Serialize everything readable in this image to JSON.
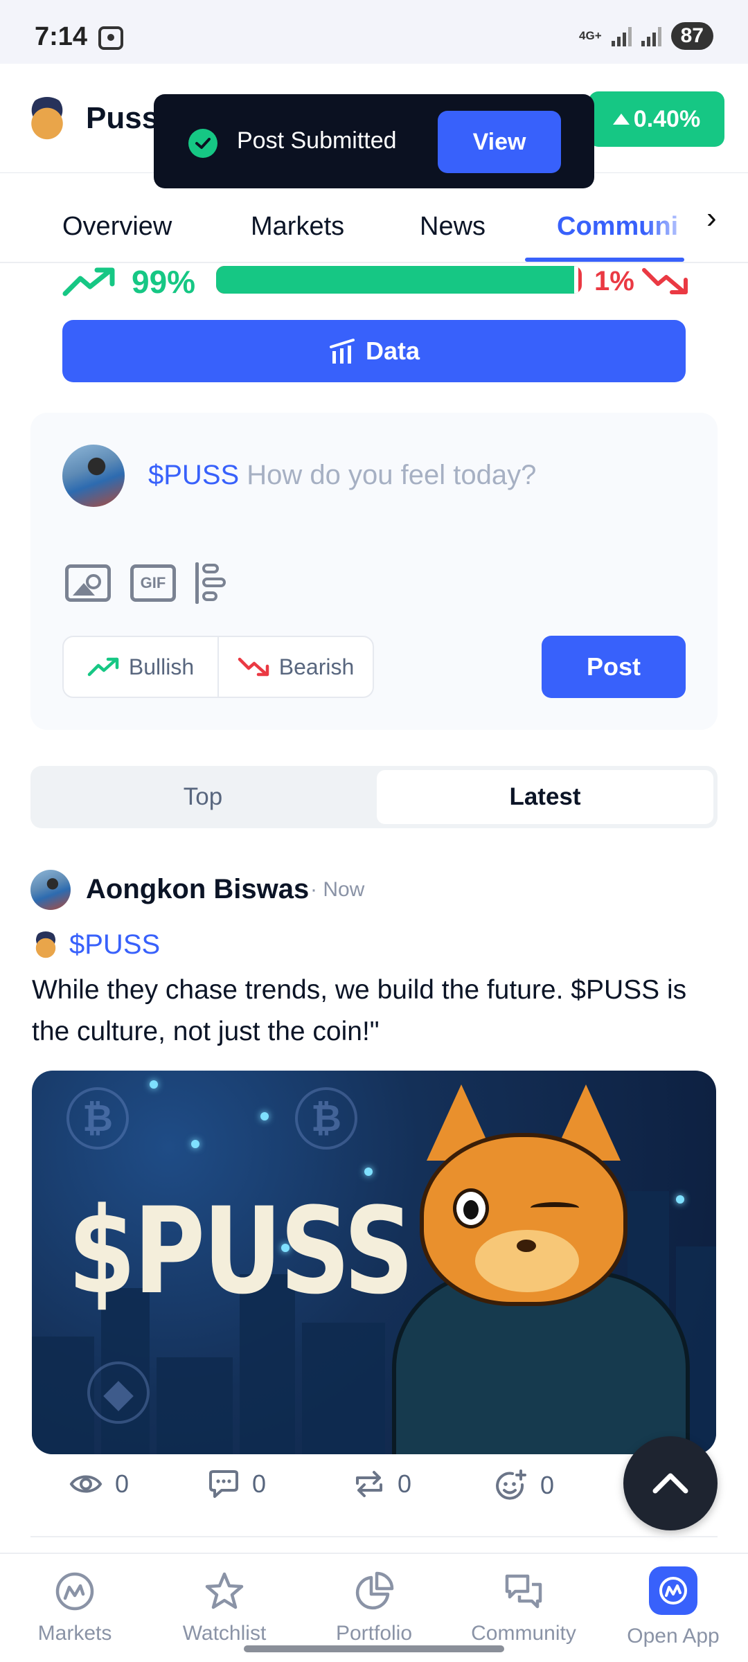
{
  "status_bar": {
    "time": "7:14",
    "network": "4G+",
    "battery": "87"
  },
  "header": {
    "coin_name": "Puss",
    "change": "0.40%",
    "change_direction": "up"
  },
  "toast": {
    "message": "Post Submitted",
    "action_label": "View"
  },
  "tabs": [
    {
      "label": "Overview",
      "active": false
    },
    {
      "label": "Markets",
      "active": false
    },
    {
      "label": "News",
      "active": false
    },
    {
      "label": "Communi",
      "active": true
    }
  ],
  "sentiment": {
    "bullish_label": "99%",
    "bearish_label": "1%",
    "bullish_fraction": 0.99
  },
  "data_button": {
    "label": "Data"
  },
  "composer": {
    "ticker": "$PUSS",
    "placeholder": "How do you feel today?",
    "tools": [
      "image-icon",
      "gif-icon",
      "poll-icon"
    ],
    "gif_label": "GIF",
    "bullish_label": "Bullish",
    "bearish_label": "Bearish",
    "post_label": "Post"
  },
  "feed_toggle": {
    "top_label": "Top",
    "latest_label": "Latest",
    "selected": "Latest"
  },
  "post": {
    "author": "Aongkon Biswas",
    "time": "· Now",
    "ticker": "$PUSS",
    "body": "While they chase trends, we build the future. $PUSS is the culture, not just the coin!\"",
    "image_text": "$PUSS",
    "stats": {
      "views": "0",
      "comments": "0",
      "reposts": "0",
      "reactions": "0"
    }
  },
  "bottom_nav": [
    {
      "label": "Markets",
      "icon": "markets-icon"
    },
    {
      "label": "Watchlist",
      "icon": "star-icon"
    },
    {
      "label": "Portfolio",
      "icon": "pie-chart-icon"
    },
    {
      "label": "Community",
      "icon": "chat-bubbles-icon"
    },
    {
      "label": "Open App",
      "icon": "app-logo-icon"
    }
  ],
  "colors": {
    "accent": "#3861fb",
    "bullish": "#16c784",
    "bearish": "#ea3943",
    "toast_bg": "#0b1121"
  }
}
